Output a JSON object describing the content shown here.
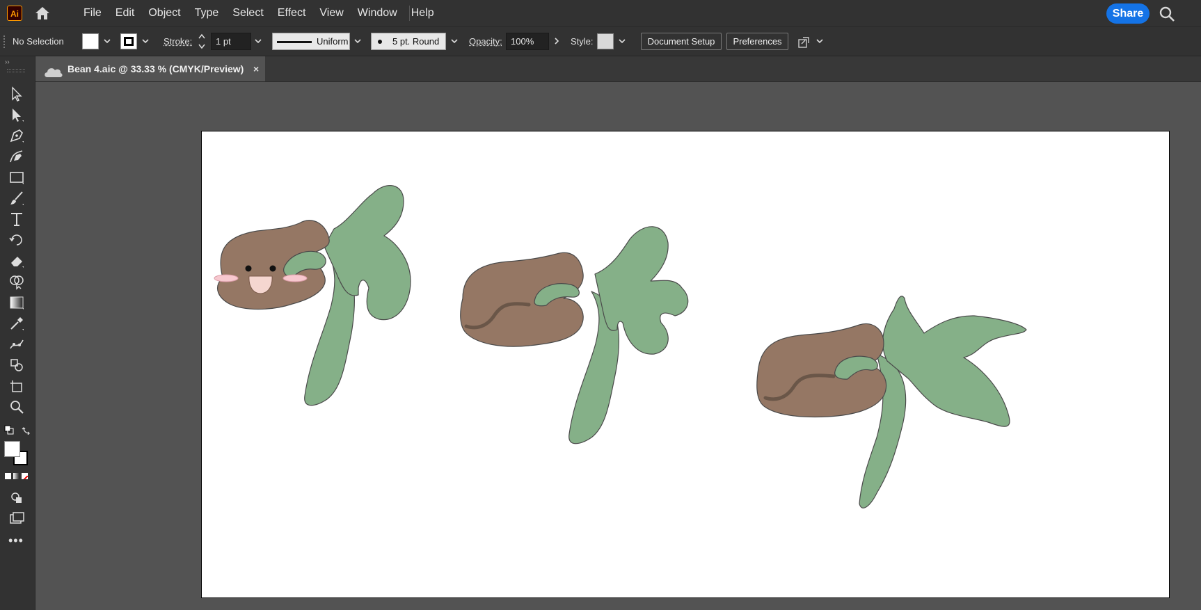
{
  "app": {
    "logo": "Ai",
    "menu": [
      "File",
      "Edit",
      "Object",
      "Type",
      "Select",
      "Effect",
      "View",
      "Window",
      "Help"
    ],
    "share_label": "Share"
  },
  "control_bar": {
    "selection_label": "No Selection",
    "stroke_label": "Stroke:",
    "stroke_weight": "1 pt",
    "profile_label": "Uniform",
    "brush_label": "5 pt. Round",
    "opacity_label": "Opacity:",
    "opacity_value": "100%",
    "style_label": "Style:",
    "document_setup_label": "Document Setup",
    "preferences_label": "Preferences"
  },
  "document": {
    "tab_title": "Bean 4.aic @ 33.33 % (CMYK/Preview)",
    "close_glyph": "×"
  },
  "colors": {
    "bean_brown": "#957764",
    "leaf_green": "#85b088",
    "cheek_pink": "#f7c8cf",
    "mouth_pink": "#f5d6d0",
    "seam_dark": "#6a5648",
    "accent_blue": "#1473e6"
  },
  "toolbar_icons": [
    "selection-tool-icon",
    "direct-selection-tool-icon",
    "pen-tool-icon",
    "curvature-tool-icon",
    "rectangle-tool-icon",
    "paintbrush-tool-icon",
    "type-tool-icon",
    "rotate-tool-icon",
    "eraser-tool-icon",
    "shape-builder-tool-icon",
    "gradient-tool-icon",
    "eyedropper-tool-icon",
    "puppet-warp-tool-icon",
    "symbol-sprayer-tool-icon",
    "artboard-tool-icon",
    "zoom-tool-icon"
  ]
}
